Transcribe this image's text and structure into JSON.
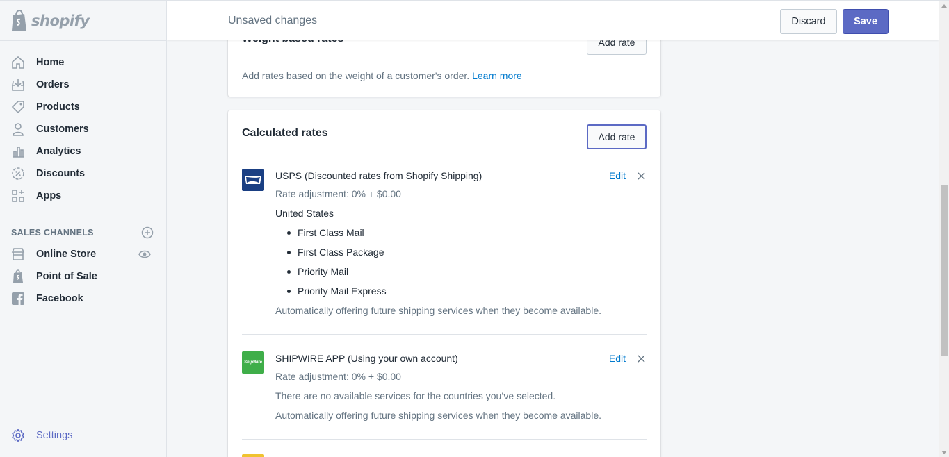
{
  "brand": {
    "name": "shopify"
  },
  "sidebar": {
    "items": [
      {
        "label": "Home",
        "icon": "home-icon"
      },
      {
        "label": "Orders",
        "icon": "orders-icon"
      },
      {
        "label": "Products",
        "icon": "tag-icon"
      },
      {
        "label": "Customers",
        "icon": "person-icon"
      },
      {
        "label": "Analytics",
        "icon": "bar-chart-icon"
      },
      {
        "label": "Discounts",
        "icon": "discount-icon"
      },
      {
        "label": "Apps",
        "icon": "apps-icon"
      }
    ],
    "sales_channels_title": "SALES CHANNELS",
    "channels": [
      {
        "label": "Online Store",
        "icon": "store-icon"
      },
      {
        "label": "Point of Sale",
        "icon": "shopify-bag-icon"
      },
      {
        "label": "Facebook",
        "icon": "facebook-icon"
      }
    ],
    "settings_label": "Settings"
  },
  "topbar": {
    "status": "Unsaved changes",
    "discard_label": "Discard",
    "save_label": "Save"
  },
  "weight_card": {
    "title": "Weight based rates",
    "add_rate_label": "Add rate",
    "description": "Add rates based on the weight of a customer's order.",
    "learn_more": "Learn more"
  },
  "calculated_card": {
    "title": "Calculated rates",
    "add_rate_label": "Add rate",
    "carriers": [
      {
        "name_strong": "USPS",
        "name_rest": " (Discounted rates from Shopify Shipping)",
        "adjustment": "Rate adjustment: 0% + $0.00",
        "region": "United States",
        "services": [
          "First Class Mail",
          "First Class Package",
          "Priority Mail",
          "Priority Mail Express"
        ],
        "footer": "Automatically offering future shipping services when they become available.",
        "edit_label": "Edit"
      },
      {
        "name_strong": "SHIPWIRE APP",
        "name_rest": " (Using your own account)",
        "adjustment": "Rate adjustment: 0% + $0.00",
        "note": "There are no available services for the countries you’ve selected.",
        "footer": "Automatically offering future shipping services when they become available.",
        "edit_label": "Edit",
        "logo_text": "ShipWire"
      }
    ]
  },
  "colors": {
    "accent": "#5c6ac4",
    "link": "#007ace",
    "usps_blue": "#1a3f83",
    "shipwire_green": "#3fae49"
  }
}
